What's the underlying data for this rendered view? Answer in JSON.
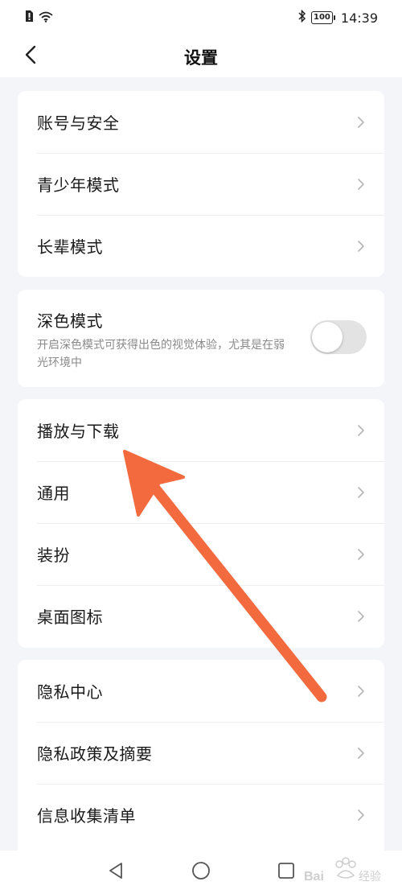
{
  "status_bar": {
    "time": "14:39",
    "battery": "100"
  },
  "header": {
    "title": "设置"
  },
  "group1": {
    "items": [
      {
        "label": "账号与安全"
      },
      {
        "label": "青少年模式"
      },
      {
        "label": "长辈模式"
      }
    ]
  },
  "dark_mode": {
    "title": "深色模式",
    "description": "开启深色模式可获得出色的视觉体验，尤其是在弱光环境中",
    "enabled": false
  },
  "group2": {
    "items": [
      {
        "label": "播放与下载"
      },
      {
        "label": "通用"
      },
      {
        "label": "装扮"
      },
      {
        "label": "桌面图标"
      }
    ]
  },
  "group3": {
    "items": [
      {
        "label": "隐私中心"
      },
      {
        "label": "隐私政策及摘要"
      },
      {
        "label": "信息收集清单"
      }
    ]
  },
  "colors": {
    "annotation_arrow": "#f26a3d",
    "background": "#f4f5f9",
    "card": "#ffffff",
    "secondary_text": "#8a8a8a"
  },
  "icons": {
    "back": "chevron-left-icon",
    "row_chevron": "chevron-right-icon",
    "nav_back": "triangle-back-icon",
    "nav_home": "circle-home-icon",
    "nav_recent": "square-recent-icon"
  }
}
